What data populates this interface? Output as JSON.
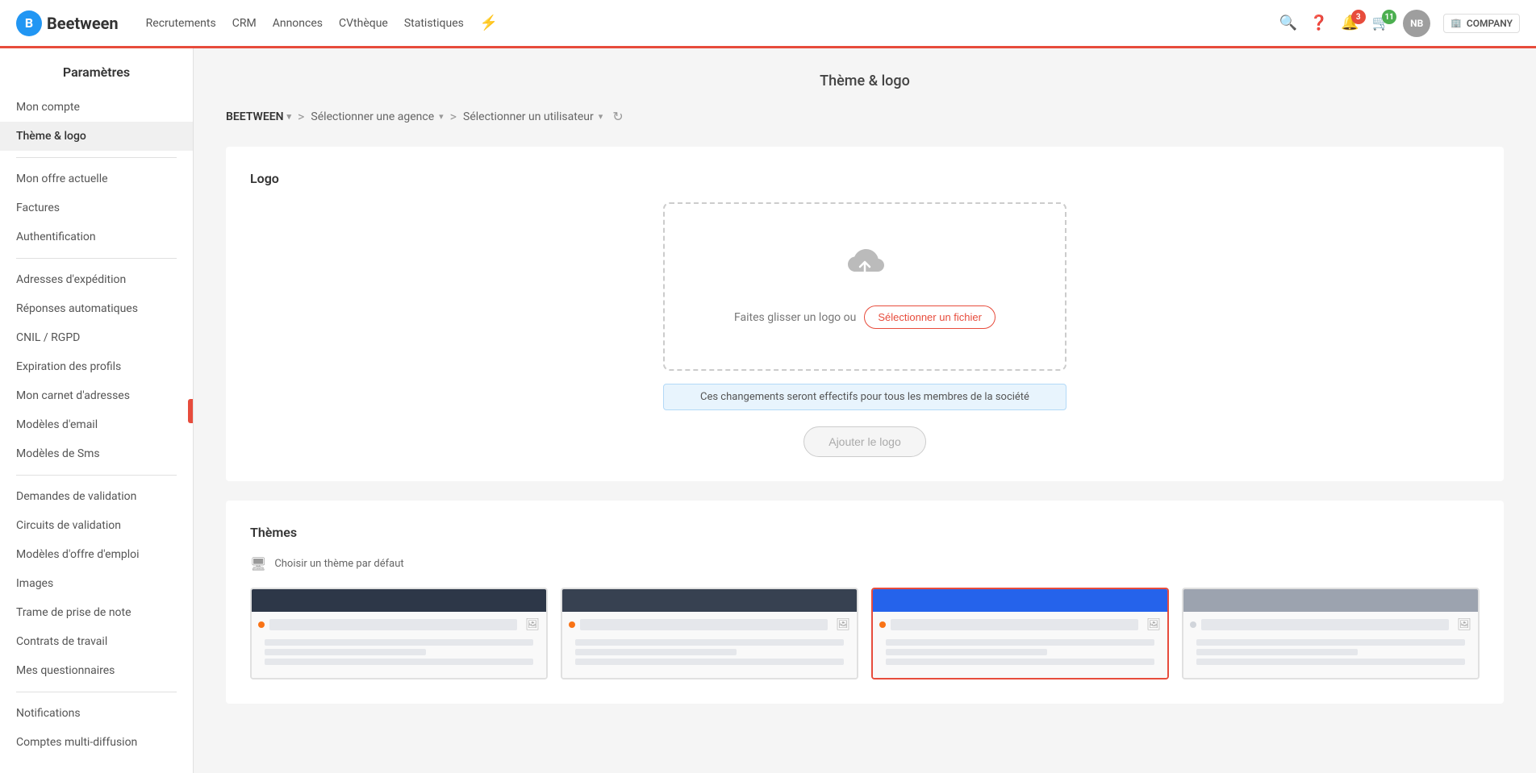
{
  "topnav": {
    "logo_letter": "B",
    "logo_text": "Beetween",
    "nav_links": [
      {
        "label": "Recrutements",
        "id": "recrutements"
      },
      {
        "label": "CRM",
        "id": "crm"
      },
      {
        "label": "Annonces",
        "id": "annonces"
      },
      {
        "label": "CVthèque",
        "id": "cvtheque"
      },
      {
        "label": "Statistiques",
        "id": "statistiques"
      }
    ],
    "notifications_count": "3",
    "cart_count": "11",
    "user_initials": "NB",
    "company_name": "COMPANY"
  },
  "sidebar": {
    "title": "Paramètres",
    "items_group1": [
      {
        "label": "Mon compte",
        "id": "mon-compte",
        "active": false
      },
      {
        "label": "Thème & logo",
        "id": "theme-logo",
        "active": true
      }
    ],
    "items_group2": [
      {
        "label": "Mon offre actuelle",
        "id": "mon-offre",
        "active": false
      },
      {
        "label": "Factures",
        "id": "factures",
        "active": false
      },
      {
        "label": "Authentification",
        "id": "auth",
        "active": false
      }
    ],
    "items_group3": [
      {
        "label": "Adresses d'expédition",
        "id": "adresses",
        "active": false
      },
      {
        "label": "Réponses automatiques",
        "id": "reponses",
        "active": false
      },
      {
        "label": "CNIL / RGPD",
        "id": "cnil",
        "active": false
      },
      {
        "label": "Expiration des profils",
        "id": "expiration",
        "active": false
      },
      {
        "label": "Mon carnet d'adresses",
        "id": "carnet",
        "active": false
      },
      {
        "label": "Modèles d'email",
        "id": "emails",
        "active": false
      },
      {
        "label": "Modèles de Sms",
        "id": "sms",
        "active": false
      }
    ],
    "items_group4": [
      {
        "label": "Demandes de validation",
        "id": "demandes",
        "active": false
      },
      {
        "label": "Circuits de validation",
        "id": "circuits",
        "active": false
      },
      {
        "label": "Modèles d'offre d'emploi",
        "id": "modeles-offre",
        "active": false
      },
      {
        "label": "Images",
        "id": "images",
        "active": false
      },
      {
        "label": "Trame de prise de note",
        "id": "trame",
        "active": false
      },
      {
        "label": "Contrats de travail",
        "id": "contrats",
        "active": false
      },
      {
        "label": "Mes questionnaires",
        "id": "questionnaires",
        "active": false
      }
    ],
    "items_group5": [
      {
        "label": "Notifications",
        "id": "notifications",
        "active": false
      },
      {
        "label": "Comptes multi-diffusion",
        "id": "multidiffusion",
        "active": false
      }
    ]
  },
  "main": {
    "page_title": "Thème & logo",
    "breadcrumb": {
      "company": "BEETWEEN",
      "select_agency": "Sélectionner une agence",
      "select_user": "Sélectionner un utilisateur"
    },
    "logo_section": {
      "title": "Logo",
      "dropzone_text": "Faites glisser un logo ou",
      "select_file_btn": "Sélectionner un fichier",
      "info_banner": "Ces changements seront effectifs pour tous les membres de la société",
      "add_logo_btn": "Ajouter le logo"
    },
    "themes_section": {
      "title": "Thèmes",
      "choose_default_label": "Choisir un thème par défaut",
      "themes": [
        {
          "id": "theme-dark",
          "header_color": "#2d3748",
          "dot_color": "orange",
          "selected": false
        },
        {
          "id": "theme-dark2",
          "header_color": "#374151",
          "dot_color": "orange",
          "selected": false
        },
        {
          "id": "theme-blue",
          "header_color": "#2563eb",
          "dot_color": "orange",
          "selected": true
        },
        {
          "id": "theme-gray",
          "header_color": "#9ca3af",
          "dot_color": "gray",
          "selected": false
        }
      ]
    }
  }
}
